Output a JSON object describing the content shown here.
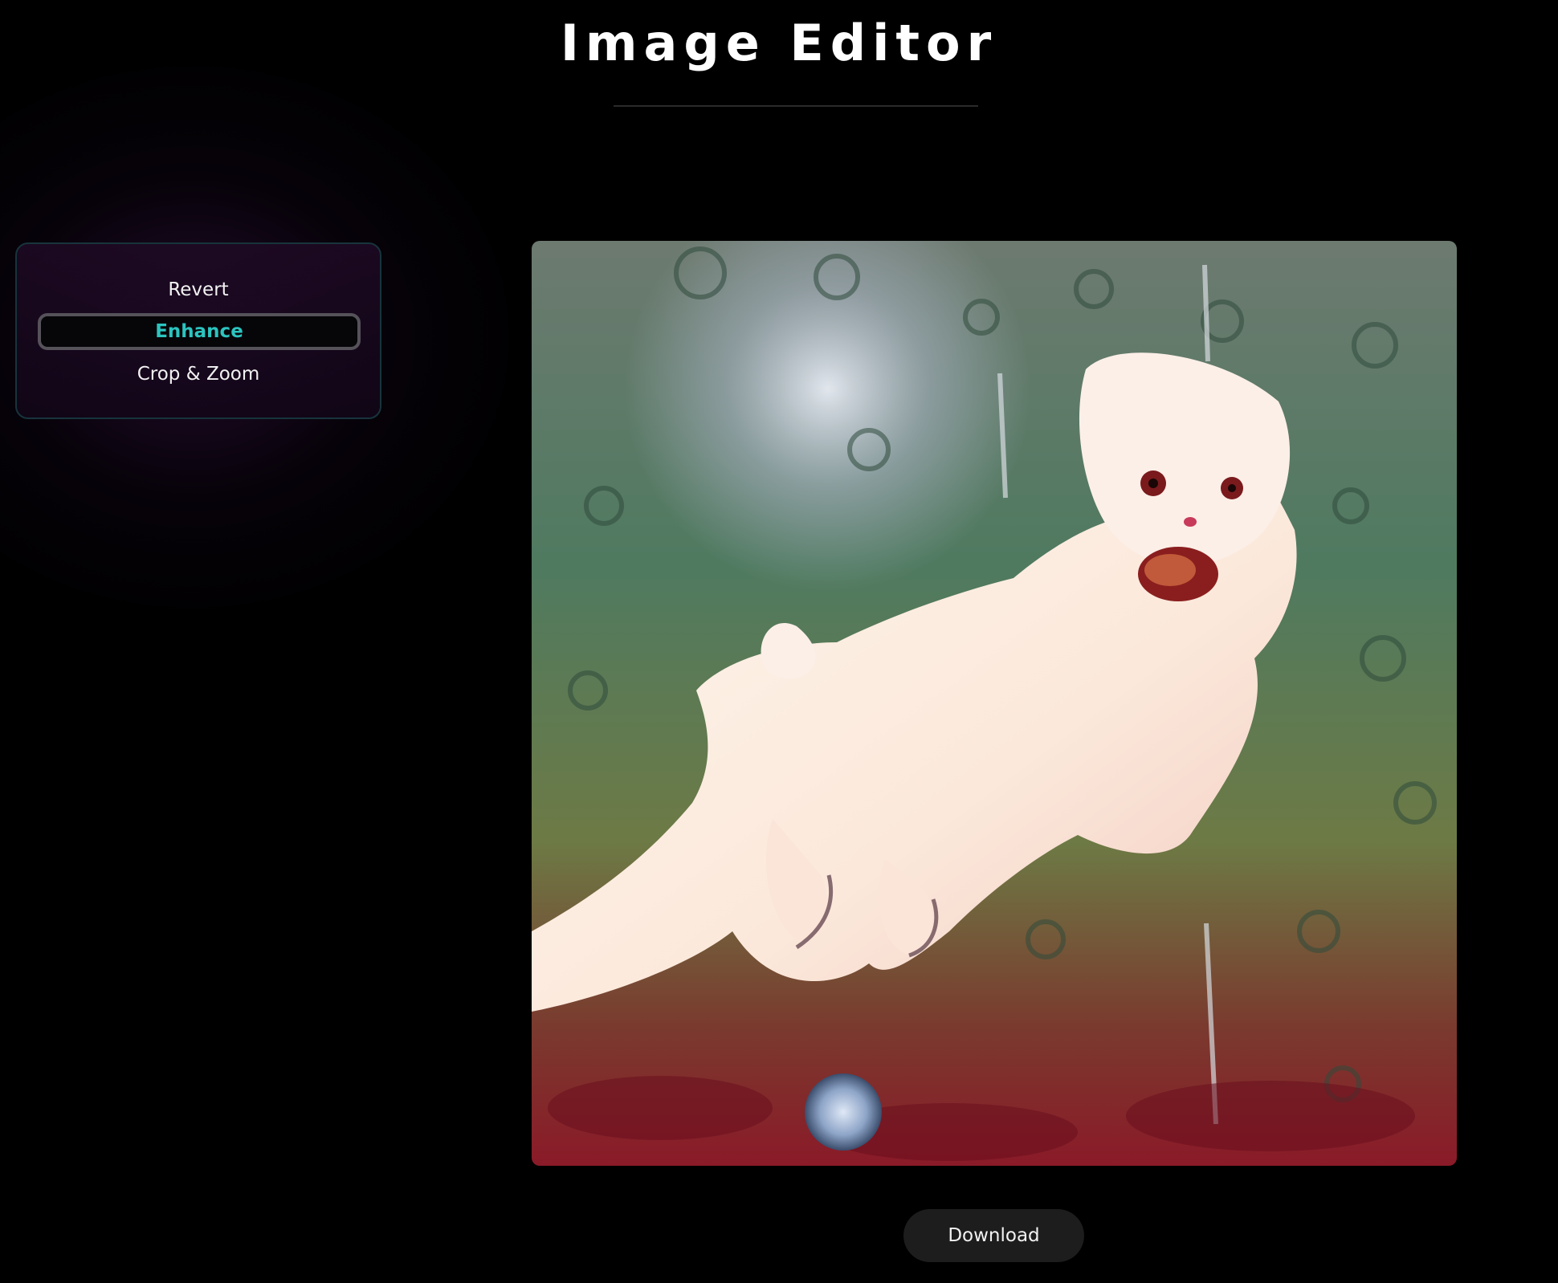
{
  "header": {
    "title": "Image Editor"
  },
  "menu": {
    "items": [
      {
        "label": "Revert",
        "active": false
      },
      {
        "label": "Enhance",
        "active": true
      },
      {
        "label": "Crop & Zoom",
        "active": false
      }
    ]
  },
  "actions": {
    "download_label": "Download"
  },
  "colors": {
    "background": "#000000",
    "accent": "#2cc4bf",
    "panel_border": "#17343c",
    "button_background": "#1d1d1d"
  }
}
